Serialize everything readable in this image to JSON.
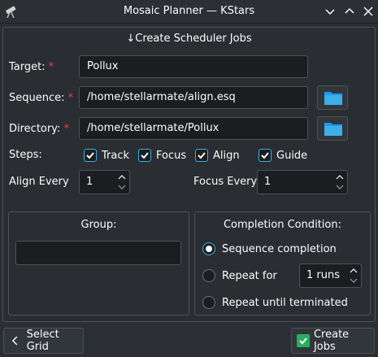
{
  "window": {
    "title": "Mosaic Planner — KStars"
  },
  "header": {
    "arrow": "↓",
    "title": "Create  Scheduler Jobs"
  },
  "form": {
    "target_label": "Target:",
    "target_value": "Pollux",
    "sequence_label": "Sequence:",
    "sequence_value": "/home/stellarmate/align.esq",
    "directory_label": "Directory:",
    "directory_value": "/home/stellarmate/Pollux",
    "required_mark": "*",
    "steps_label": "Steps:",
    "steps": [
      {
        "label": "Track",
        "checked": true
      },
      {
        "label": "Focus",
        "checked": true
      },
      {
        "label": "Align",
        "checked": true
      },
      {
        "label": "Guide",
        "checked": true
      }
    ],
    "align_every_label": "Align Every",
    "align_every_value": "1",
    "focus_every_label": "Focus Every",
    "focus_every_value": "1"
  },
  "group": {
    "title": "Group:",
    "value": ""
  },
  "completion": {
    "title": "Completion Condition:",
    "options": [
      {
        "label": "Sequence completion",
        "selected": true
      },
      {
        "label": "Repeat for",
        "selected": false
      },
      {
        "label": "Repeat until terminated",
        "selected": false
      }
    ],
    "repeat_value": "1 runs"
  },
  "buttons": {
    "select_grid": "Select Grid",
    "select_grid_icon": "chevron-left-icon",
    "create_jobs": "Create Jobs",
    "create_jobs_icon": "checkmark-icon"
  },
  "colors": {
    "accent": "#3daee9",
    "required": "#da4453",
    "check_green": "#27ae60"
  }
}
